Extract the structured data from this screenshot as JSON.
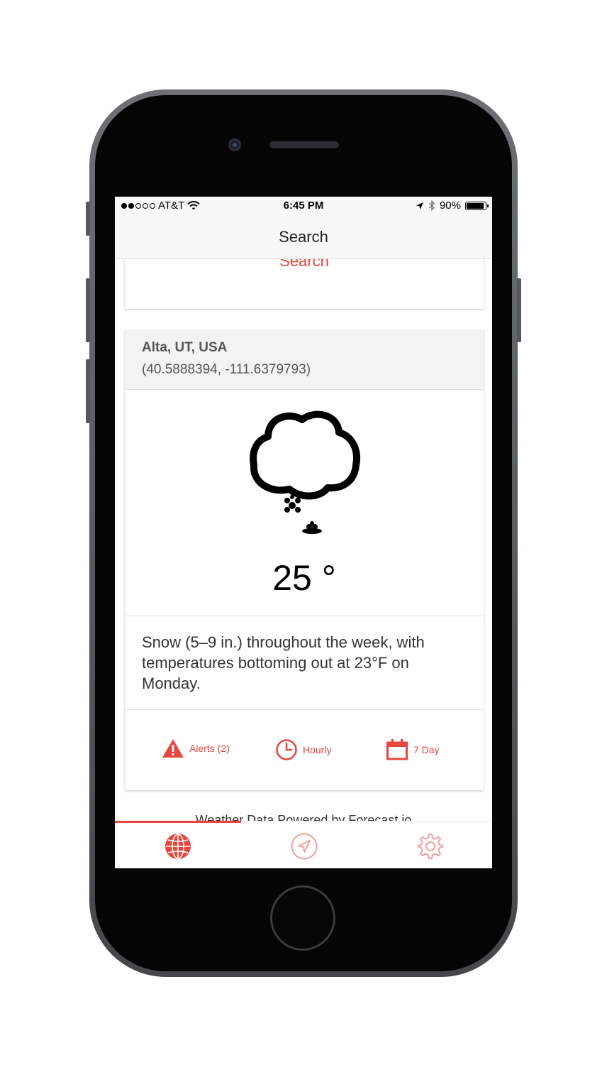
{
  "status_bar": {
    "carrier": "AT&T",
    "time": "6:45 PM",
    "battery": "90%",
    "signal_bars_filled": 2,
    "signal_bars_total": 5
  },
  "nav": {
    "title": "Search"
  },
  "search_card": {
    "link_label": "Search"
  },
  "weather_card": {
    "location": "Alta, UT, USA",
    "coords": "(40.5888394, -111.6379793)",
    "icon": "snow-icon",
    "temperature": "25 °",
    "summary": "Snow (5–9 in.) throughout the week, with temperatures bottoming out at 23°F on Monday.",
    "actions": {
      "alerts": "Alerts (2)",
      "hourly": "Hourly",
      "seven_day": "7 Day"
    }
  },
  "footer": {
    "powered_by": "Weather Data Powered by Forecast.io"
  },
  "tab_bar": {
    "tabs": [
      "globe-icon",
      "location-arrow-icon",
      "gear-icon"
    ],
    "active_tab": "globe-icon"
  },
  "colors": {
    "accent": "#e8453c",
    "nav_bg": "#f8f8f8",
    "header_bg": "#f3f3f3"
  }
}
